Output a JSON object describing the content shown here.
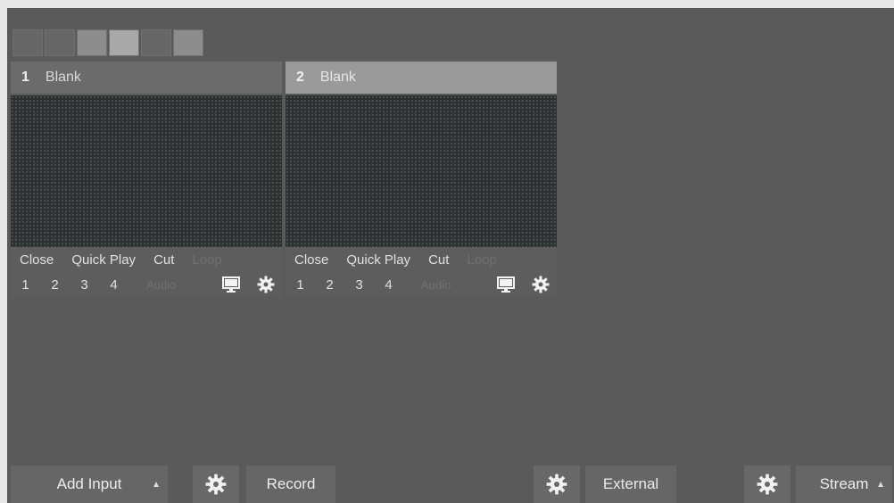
{
  "inputs": [
    {
      "number": "1",
      "title": "Blank",
      "actions": {
        "close": "Close",
        "quick_play": "Quick Play",
        "cut": "Cut",
        "loop": "Loop"
      },
      "overlays": [
        "1",
        "2",
        "3",
        "4"
      ],
      "audio": "Audio"
    },
    {
      "number": "2",
      "title": "Blank",
      "actions": {
        "close": "Close",
        "quick_play": "Quick Play",
        "cut": "Cut",
        "loop": "Loop"
      },
      "overlays": [
        "1",
        "2",
        "3",
        "4"
      ],
      "audio": "Audio"
    }
  ],
  "toolbar": {
    "add_input": "Add Input",
    "record": "Record",
    "external": "External",
    "stream": "Stream"
  },
  "icons": {
    "settings": "gear-icon",
    "monitor": "monitor-icon",
    "caret": "caret-icon"
  }
}
